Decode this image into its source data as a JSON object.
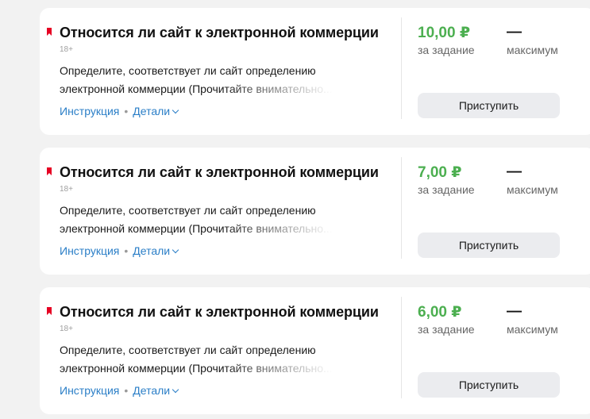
{
  "tasks": [
    {
      "title": "Относится ли сайт к электронной коммерции",
      "age": "18+",
      "description_line1": "Определите, соответствует ли сайт определению",
      "description_line2": "электронной коммерции (Прочитайте внимательно...",
      "instruction_label": "Инструкция",
      "separator": "•",
      "details_label": "Детали",
      "price": "10,00 ₽",
      "price_label": "за задание",
      "max_value": "—",
      "max_label": "максимум",
      "button_label": "Приступить"
    },
    {
      "title": "Относится ли сайт к электронной коммерции",
      "age": "18+",
      "description_line1": "Определите, соответствует ли сайт определению",
      "description_line2": "электронной коммерции (Прочитайте внимательно...",
      "instruction_label": "Инструкция",
      "separator": "•",
      "details_label": "Детали",
      "price": "7,00 ₽",
      "price_label": "за задание",
      "max_value": "—",
      "max_label": "максимум",
      "button_label": "Приступить"
    },
    {
      "title": "Относится ли сайт к электронной коммерции",
      "age": "18+",
      "description_line1": "Определите, соответствует ли сайт определению",
      "description_line2": "электронной коммерции (Прочитайте внимательно...",
      "instruction_label": "Инструкция",
      "separator": "•",
      "details_label": "Детали",
      "price": "6,00 ₽",
      "price_label": "за задание",
      "max_value": "—",
      "max_label": "максимум",
      "button_label": "Приступить"
    }
  ],
  "colors": {
    "price_green": "#4caf50",
    "link_blue": "#2a7ec7",
    "bookmark_red": "#e60023"
  },
  "icons": {
    "bookmark": "bookmark-icon",
    "details_chevron": "chevron-down-icon"
  }
}
